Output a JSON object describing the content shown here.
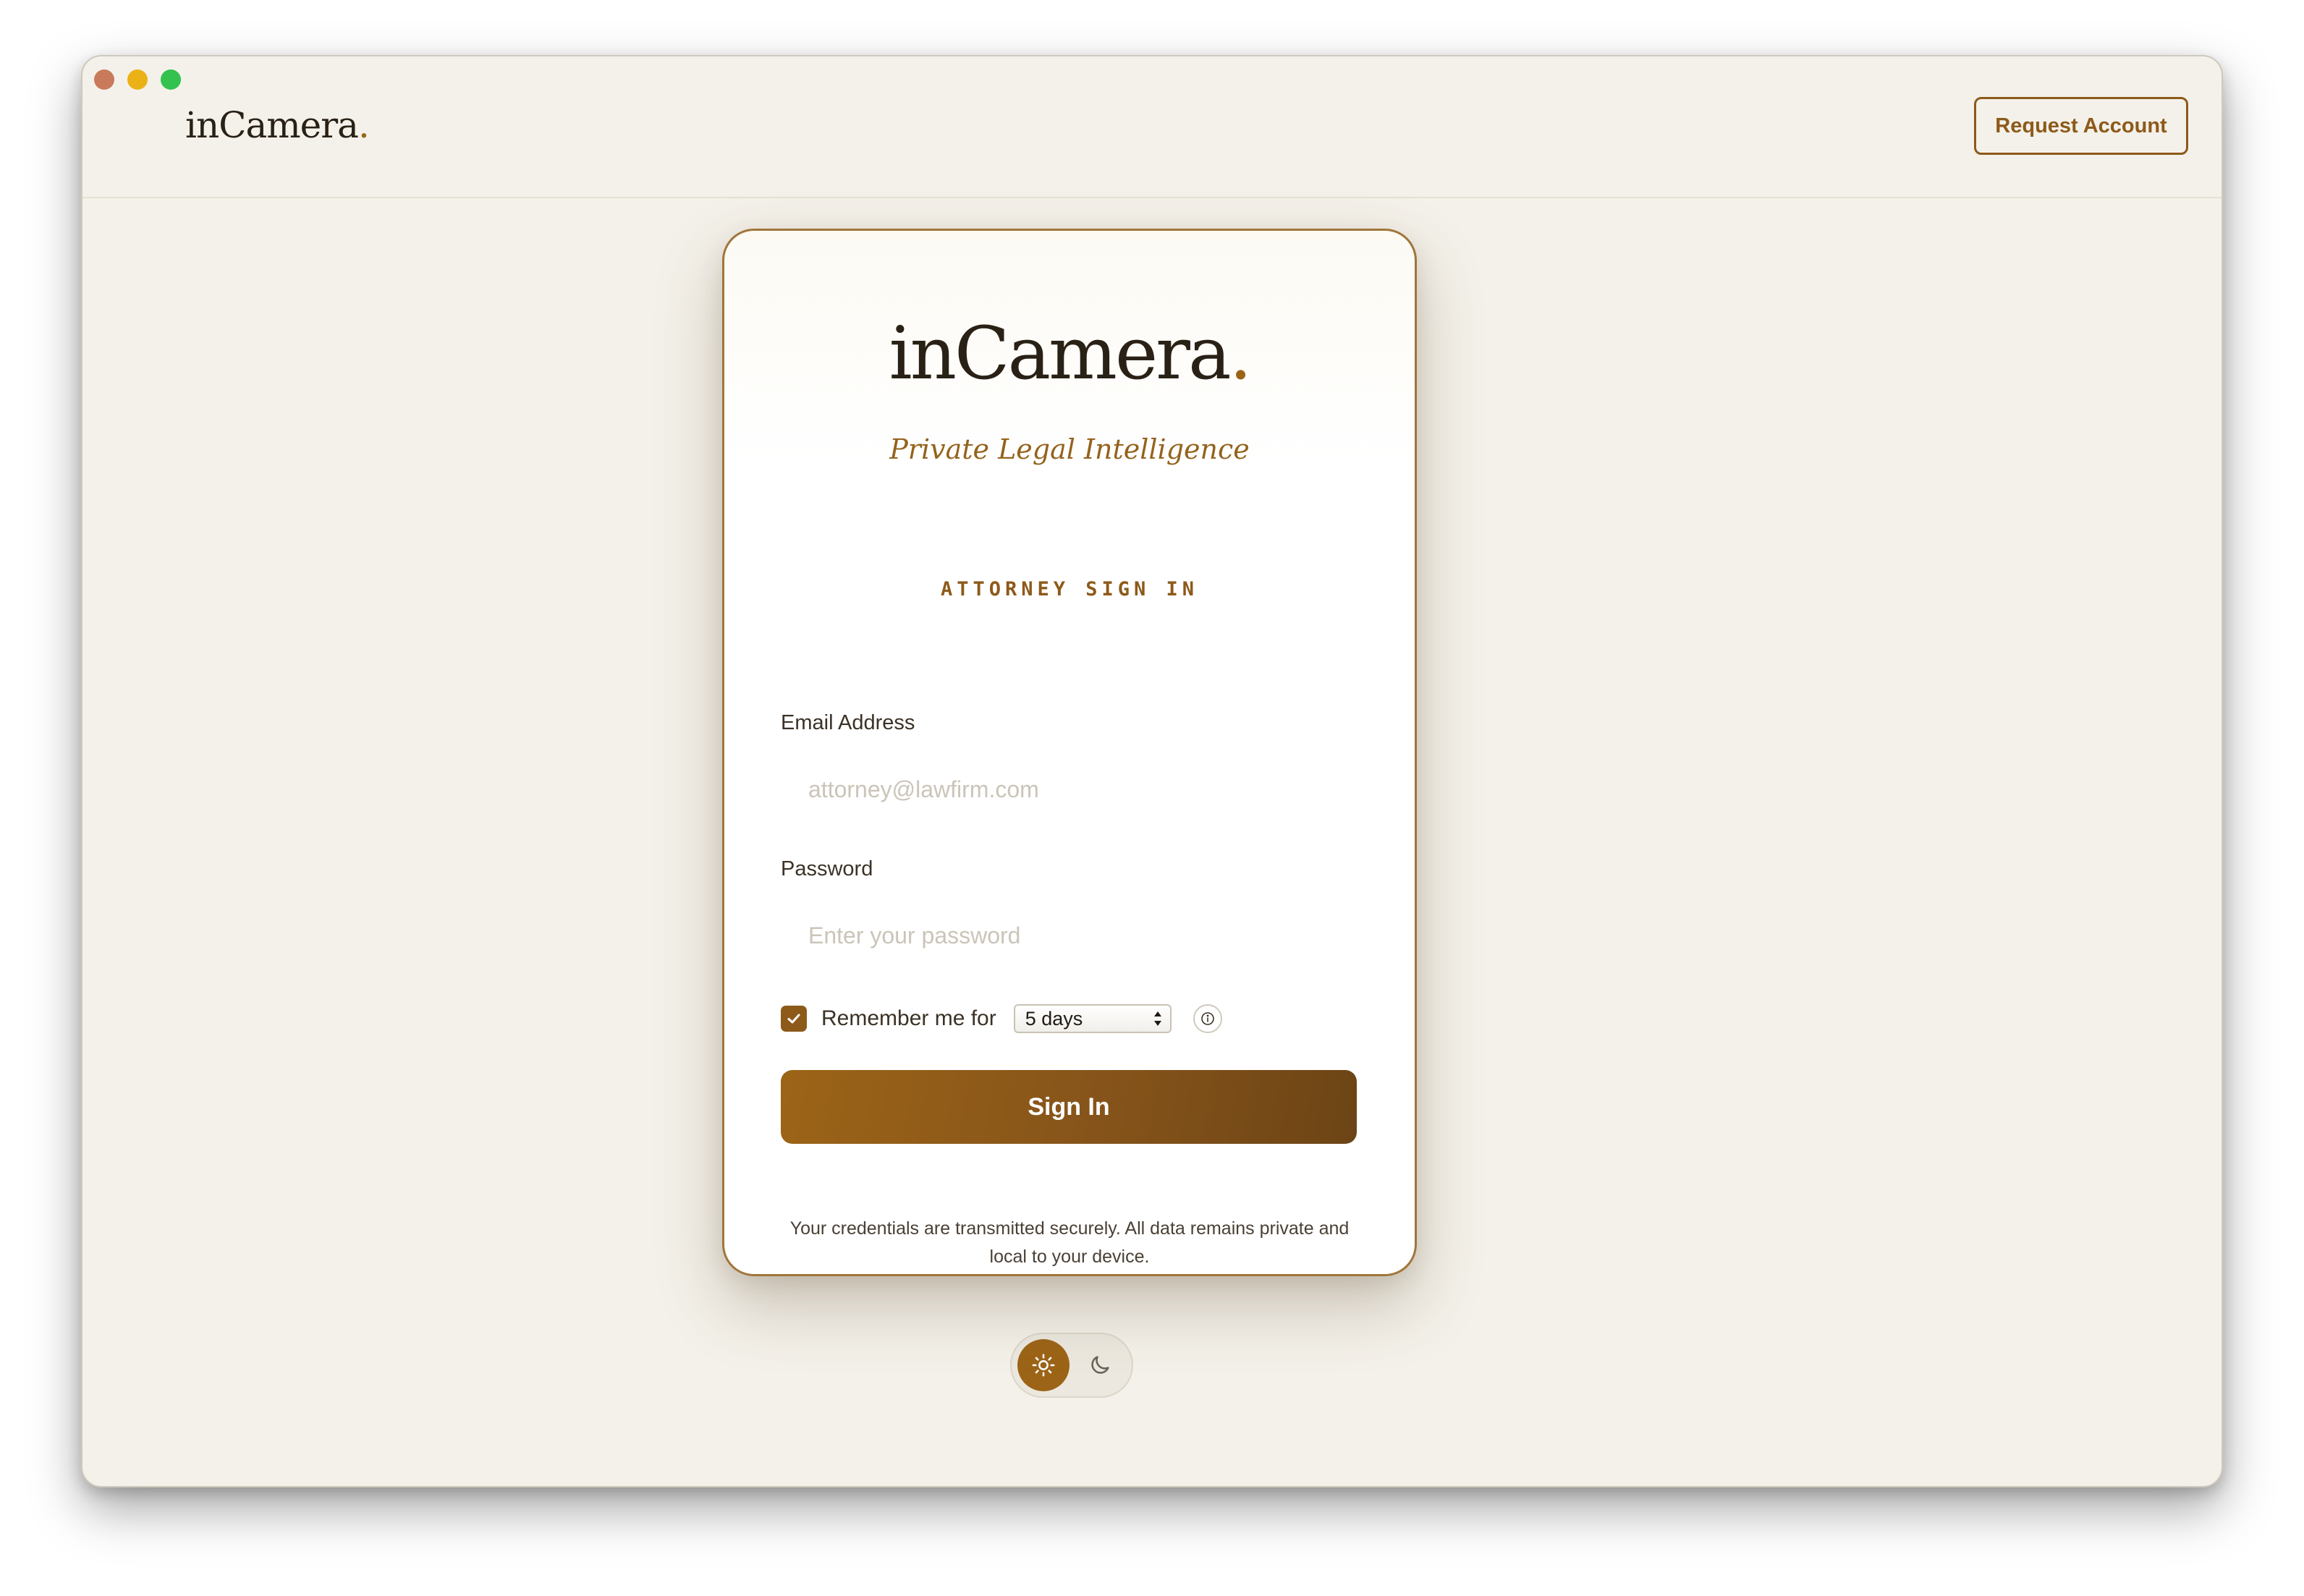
{
  "app": {
    "brand_name": "inCamera",
    "brand_dot": "."
  },
  "header": {
    "request_account_label": "Request Account"
  },
  "card": {
    "brand_name": "inCamera",
    "brand_dot": ".",
    "tagline": "Private Legal Intelligence",
    "heading": "ATTORNEY SIGN IN",
    "email": {
      "label": "Email Address",
      "value": "",
      "placeholder": "attorney@lawfirm.com"
    },
    "password": {
      "label": "Password",
      "value": "",
      "placeholder": "Enter your password"
    },
    "remember": {
      "checked": true,
      "label": "Remember me for",
      "selected_option": "5 days"
    },
    "submit_label": "Sign In",
    "security_note": "Your credentials are transmitted securely. All data remains private and local to your device."
  },
  "theme": {
    "active": "light",
    "icons": [
      "sun-icon",
      "moon-icon"
    ]
  },
  "colors": {
    "accent": "#8d5a1a",
    "background": "#f4f1ea",
    "text": "#2a2116"
  }
}
